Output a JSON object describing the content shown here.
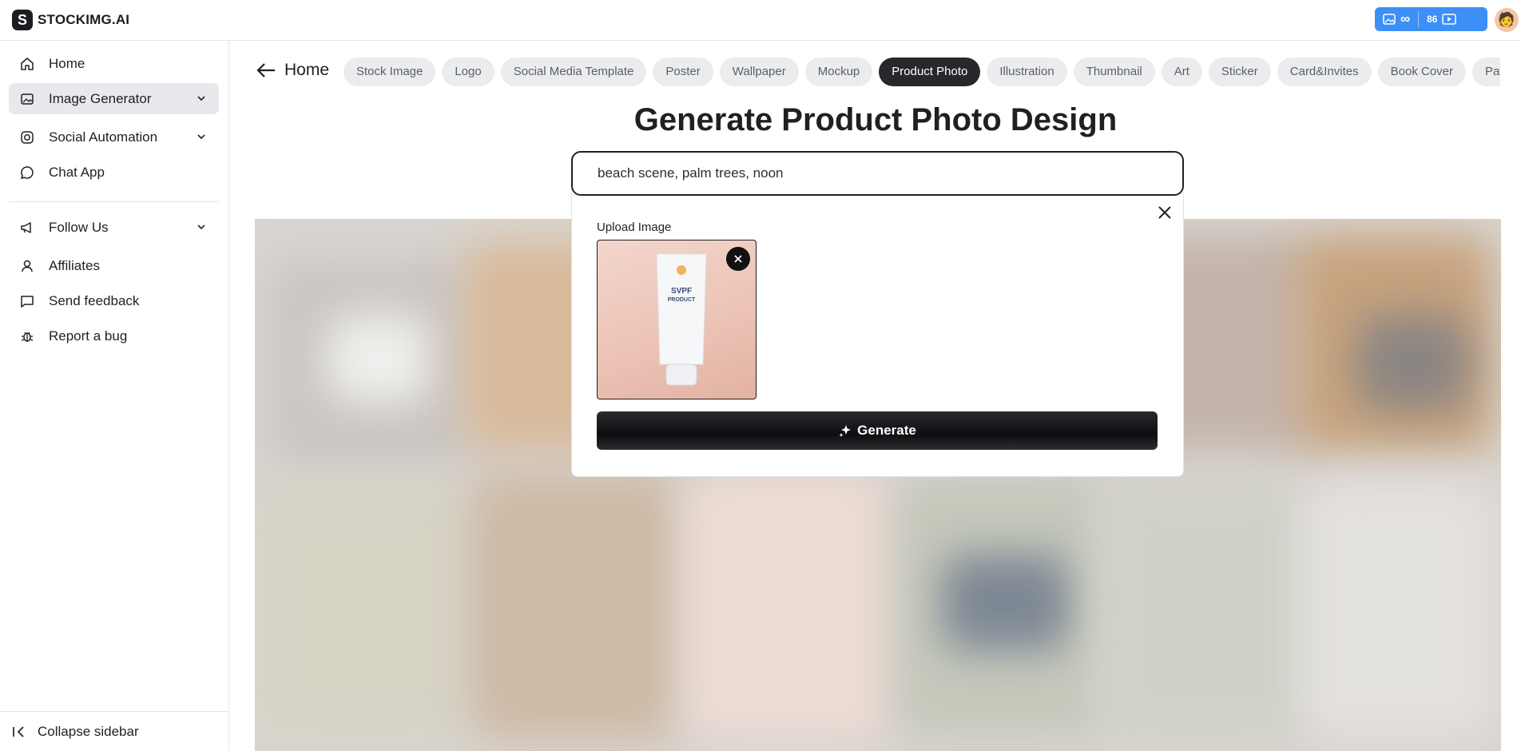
{
  "app": {
    "logo_mark": "S",
    "logo_text": "STOCKIMG.AI"
  },
  "credits": {
    "left_symbol": "∞",
    "count": "86"
  },
  "sidebar": {
    "items": [
      {
        "label": "Home",
        "icon": "home-icon"
      },
      {
        "label": "Image Generator",
        "icon": "image-icon",
        "active": true,
        "expandable": true
      },
      {
        "label": "Social Automation",
        "icon": "instagram-icon",
        "expandable": true
      },
      {
        "label": "Chat App",
        "icon": "chat-icon"
      }
    ],
    "secondary": [
      {
        "label": "Follow Us",
        "icon": "megaphone-icon",
        "expandable": true
      },
      {
        "label": "Affiliates",
        "icon": "user-icon"
      },
      {
        "label": "Send feedback",
        "icon": "feedback-icon"
      },
      {
        "label": "Report a bug",
        "icon": "bug-icon"
      }
    ],
    "collapse_label": "Collapse sidebar"
  },
  "header": {
    "back_label": "Home"
  },
  "categories": [
    "Stock Image",
    "Logo",
    "Social Media Template",
    "Poster",
    "Wallpaper",
    "Mockup",
    "Product Photo",
    "Illustration",
    "Thumbnail",
    "Art",
    "Sticker",
    "Card&Invites",
    "Book Cover",
    "Pattern"
  ],
  "selected_category": "Product Photo",
  "page_title": "Generate Product Photo Design",
  "prompt": {
    "value": "beach scene, palm trees, noon"
  },
  "upload": {
    "label": "Upload Image",
    "product_text_line1": "SVPF",
    "product_text_line2": "PRODUCT"
  },
  "generate_label": "Generate",
  "colors": {
    "accent": "#3d8ff6",
    "dark": "#27282b",
    "chip": "#ebecee"
  }
}
